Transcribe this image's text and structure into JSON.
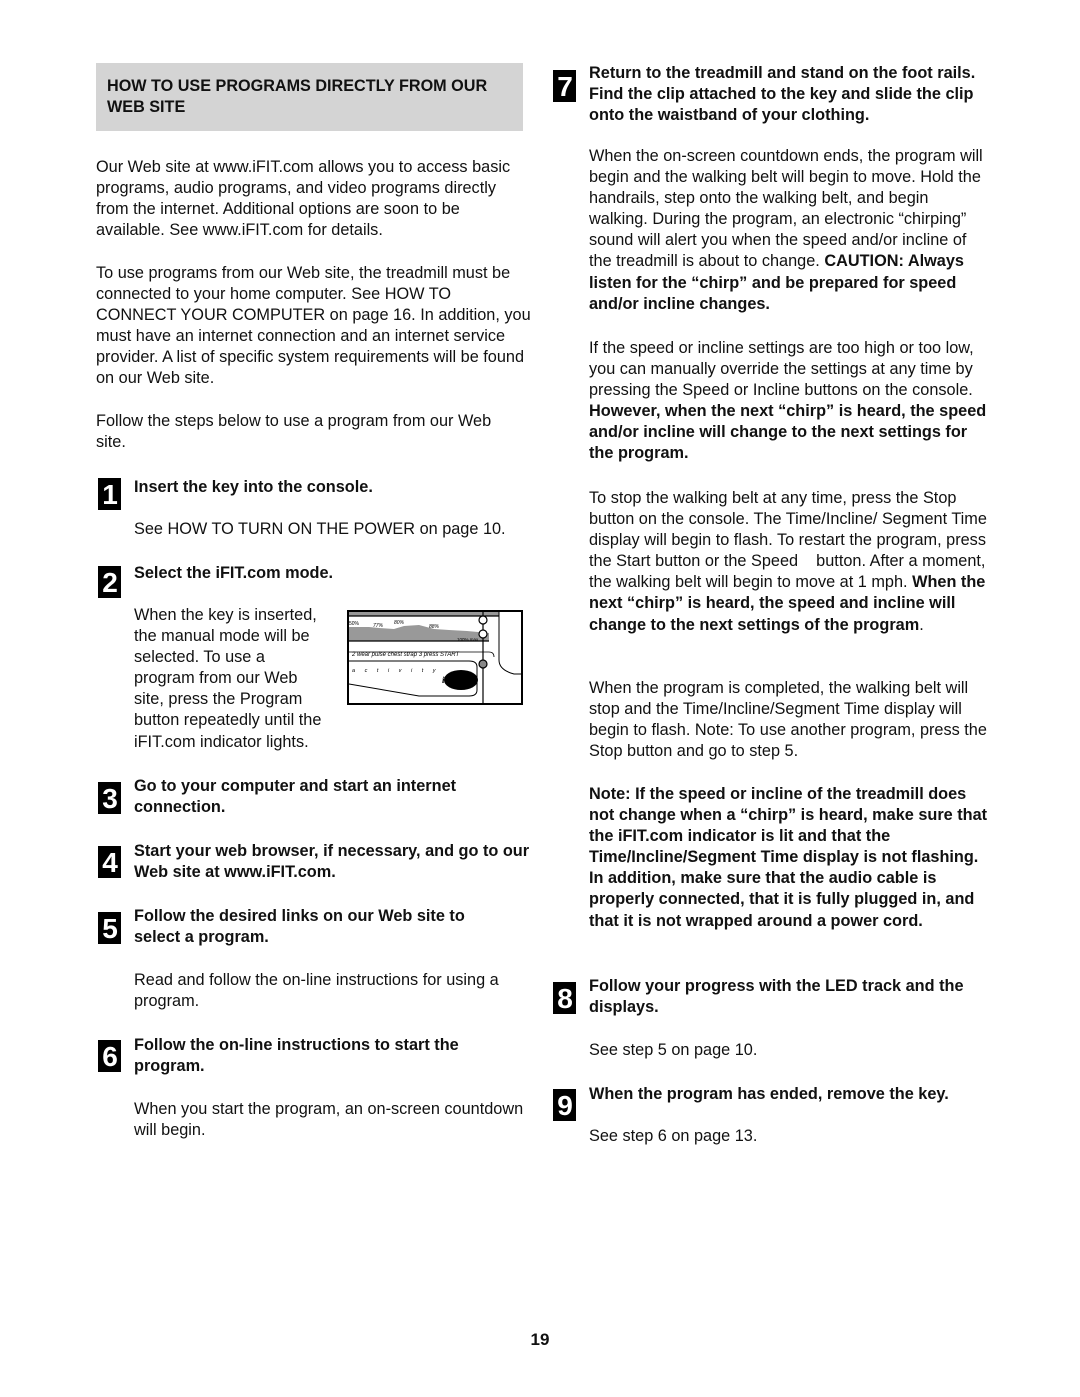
{
  "section_header": "HOW TO USE PROGRAMS DIRECTLY FROM OUR WEB SITE",
  "intro": {
    "p1": "Our Web site at www.iFIT.com allows you to access basic programs, audio programs, and video programs directly from the internet. Additional options are soon to be available. See www.iFIT.com for details.",
    "p2": "To use programs from our Web site, the treadmill must be connected to your home computer. See HOW TO CONNECT YOUR COMPUTER on page 16. In addition, you must have an internet connection and an internet service provider. A list of specific system requirements will be found on our Web site.",
    "p3": "Follow the steps below to use a program from our Web site."
  },
  "steps": [
    {
      "number": "1",
      "title": "Insert the key into the console.",
      "body": "See HOW TO TURN ON THE POWER on page 10."
    },
    {
      "number": "2",
      "title": "Select the iFIT.com mode.",
      "body": "When the key is inserted, the manual mode will be selected. To use a program from our Web site, press the Program button repeatedly until the iFIT.com indicator lights."
    },
    {
      "number": "3",
      "title": "Go to your computer and start an internet connection."
    },
    {
      "number": "4",
      "title": "Start your web browser, if necessary, and go to our Web site at www.iFIT.com."
    },
    {
      "number": "5",
      "title": "Follow the desired links on our Web site to select a program.",
      "body": "Read and follow the on-line instructions for using a program."
    },
    {
      "number": "6",
      "title": "Follow the on-line instructions to start the program.",
      "body": "When you start the program, an on-screen countdown will begin."
    },
    {
      "number": "7",
      "title": "Return to the treadmill and stand on the foot rails. Find the clip attached to the key and slide the clip onto the waistband of your clothing.",
      "body1": "When the on-screen countdown ends, the program will begin and the walking belt will begin to move. Hold the handrails, step onto the walking belt, and begin walking. During the program, an electronic “chirping” sound will alert you when the speed and/or incline of the treadmill is about to change.",
      "body1_bold": "CAUTION: Always listen for the “chirp” and be prepared for speed and/or incline changes.",
      "body2": "If the speed or incline settings are too high or too low, you can manually override the settings at any time by pressing the Speed or Incline buttons on the console.",
      "body2_bold": "However, when the next “chirp” is heard, the speed and/or incline will change to the next settings for the program.",
      "body3": "To stop the walking belt at any time, press the Stop button on the console. The Time/Incline/ Segment Time display will begin to flash. To restart the program, press the Start button or the Speed    button. After a moment, the walking belt will begin to move at 1 mph.",
      "body3_bold": "When the next “chirp” is heard, the speed and incline will change to the next settings of the program",
      "body3_end": ".",
      "body4": "When the program is completed, the walking belt will stop and the Time/Incline/Segment Time display will begin to flash. Note: To use another program, press the Stop button and go to step 5.",
      "note_bold": "Note: If the speed or incline of the treadmill does not change when a “chirp” is heard, make sure that the iFIT.com indicator is lit and that the Time/Incline/Segment Time display is not flashing. In addition, make sure that the audio cable is properly connected, that it is fully plugged in, and that it is not wrapped around a power cord."
    },
    {
      "number": "8",
      "title": "Follow your progress with the LED track and the displays.",
      "body": "See step 5 on page 10."
    },
    {
      "number": "9",
      "title": "When the program has ended, remove the key.",
      "body": "See step 6 on page 13."
    }
  ],
  "console_illustration": {
    "percent_labels": [
      "50%",
      "77%",
      "80%",
      "88%"
    ],
    "max_label": "100% max",
    "instruction": "2 wear pulse chest strap 3 press START",
    "activity_label": "a c t i v i t y",
    "logo": "iFIT.com"
  },
  "page_number": "19"
}
